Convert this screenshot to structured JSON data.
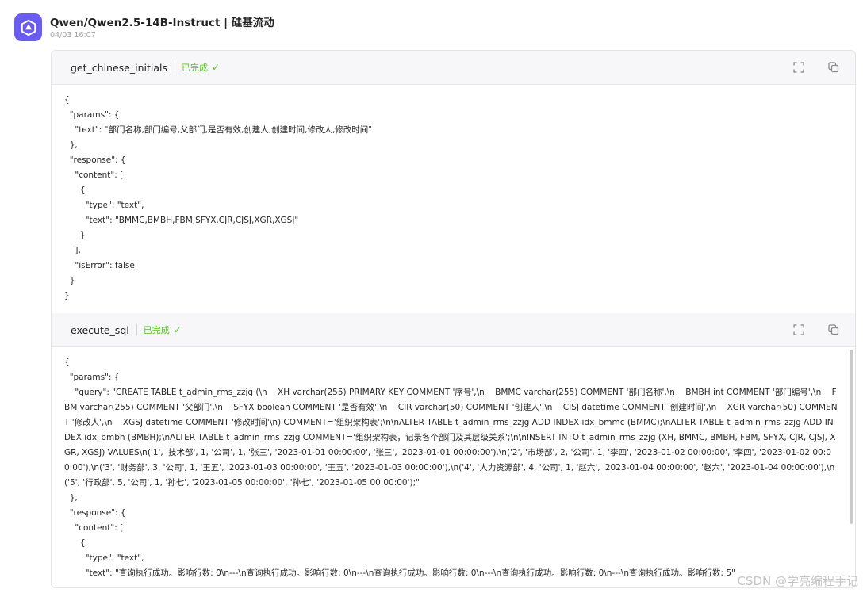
{
  "message": {
    "title": "Qwen/Qwen2.5-14B-Instruct | 硅基流动",
    "time": "04/03 16:07",
    "avatar_icon": "qwen-logo-icon"
  },
  "colors": {
    "accent": "#6b5cf0",
    "success": "#52c41a"
  },
  "tool_calls": [
    {
      "name": "get_chinese_initials",
      "status": "已完成",
      "lines": [
        "{",
        "  \"params\": {",
        "    \"text\": \"部门名称,部门编号,父部门,是否有效,创建人,创建时间,修改人,修改时间\"",
        "  },",
        "  \"response\": {",
        "    \"content\": [",
        "      {",
        "        \"type\": \"text\",",
        "        \"text\": \"BMMC,BMBH,FBM,SFYX,CJR,CJSJ,XGR,XGSJ\"",
        "      }",
        "    ],",
        "    \"isError\": false",
        "  }",
        "}"
      ]
    },
    {
      "name": "execute_sql",
      "status": "已完成",
      "lines": [
        "{",
        "  \"params\": {",
        "    \"query\": \"CREATE TABLE t_admin_rms_zzjg (\\n    XH varchar(255) PRIMARY KEY COMMENT '序号',\\n    BMMC varchar(255) COMMENT '部门名称',\\n    BMBH int COMMENT '部门编号',\\n    FBM varchar(255) COMMENT '父部门',\\n    SFYX boolean COMMENT '是否有效',\\n    CJR varchar(50) COMMENT '创建人',\\n    CJSJ datetime COMMENT '创建时间',\\n    XGR varchar(50) COMMENT '修改人',\\n    XGSJ datetime COMMENT '修改时间'\\n) COMMENT='组织架构表';\\n\\nALTER TABLE t_admin_rms_zzjg ADD INDEX idx_bmmc (BMMC);\\nALTER TABLE t_admin_rms_zzjg ADD INDEX idx_bmbh (BMBH);\\nALTER TABLE t_admin_rms_zzjg COMMENT='组织架构表，记录各个部门及其层级关系';\\n\\nINSERT INTO t_admin_rms_zzjg (XH, BMMC, BMBH, FBM, SFYX, CJR, CJSJ, XGR, XGSJ) VALUES\\n('1', '技术部', 1, '公司', 1, '张三', '2023-01-01 00:00:00', '张三', '2023-01-01 00:00:00'),\\n('2', '市场部', 2, '公司', 1, '李四', '2023-01-02 00:00:00', '李四', '2023-01-02 00:00:00'),\\n('3', '财务部', 3, '公司', 1, '王五', '2023-01-03 00:00:00', '王五', '2023-01-03 00:00:00'),\\n('4', '人力资源部', 4, '公司', 1, '赵六', '2023-01-04 00:00:00', '赵六', '2023-01-04 00:00:00'),\\n('5', '行政部', 5, '公司', 1, '孙七', '2023-01-05 00:00:00', '孙七', '2023-01-05 00:00:00');\"",
        "  },",
        "  \"response\": {",
        "    \"content\": [",
        "      {",
        "        \"type\": \"text\",",
        "        \"text\": \"查询执行成功。影响行数: 0\\n---\\n查询执行成功。影响行数: 0\\n---\\n查询执行成功。影响行数: 0\\n---\\n查询执行成功。影响行数: 0\\n---\\n查询执行成功。影响行数: 5\""
      ]
    }
  ],
  "watermark": "CSDN @学亮编程手记"
}
